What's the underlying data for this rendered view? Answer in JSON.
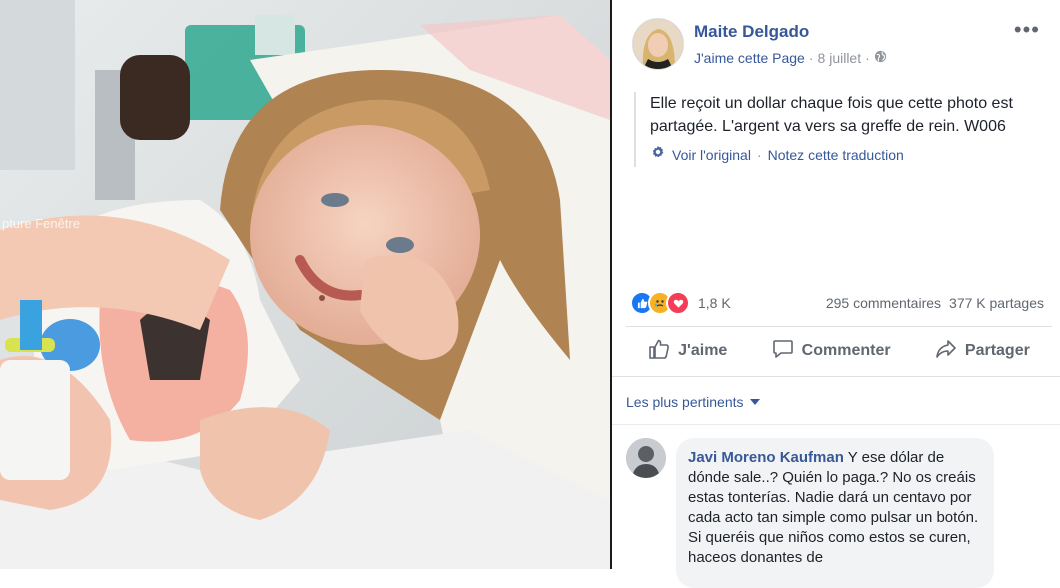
{
  "photo": {
    "watermark": "pture Fenêtre"
  },
  "post": {
    "author": "Maite Delgado",
    "like_page": "J'aime cette Page",
    "dot": "·",
    "date": "8 juillet",
    "privacy_icon": "globe-icon",
    "more_icon": "more-options-icon",
    "text": "Elle reçoit un dollar chaque fois que cette photo est partagée. L'argent va vers sa greffe de rein. W006",
    "see_original": "Voir l'original",
    "rate_translation": "Notez cette traduction",
    "reactions_count": "1,8 K",
    "comments_count": "295 commentaires",
    "shares_count": "377 K partages",
    "reaction_colors": {
      "like": "#1877f2",
      "sad": "#f7b125",
      "love": "#f33e58"
    }
  },
  "actions": {
    "like": "J'aime",
    "comment": "Commenter",
    "share": "Partager"
  },
  "comments": {
    "filter": "Les plus pertinents",
    "items": [
      {
        "author": "Javi Moreno Kaufman",
        "text": "Y ese dólar de dónde sale..? Quién lo paga.? No os creáis estas tonterías. Nadie dará un centavo por cada acto tan simple como pulsar un botón. Si queréis que niños como estos se curen, haceos donantes de"
      }
    ]
  }
}
